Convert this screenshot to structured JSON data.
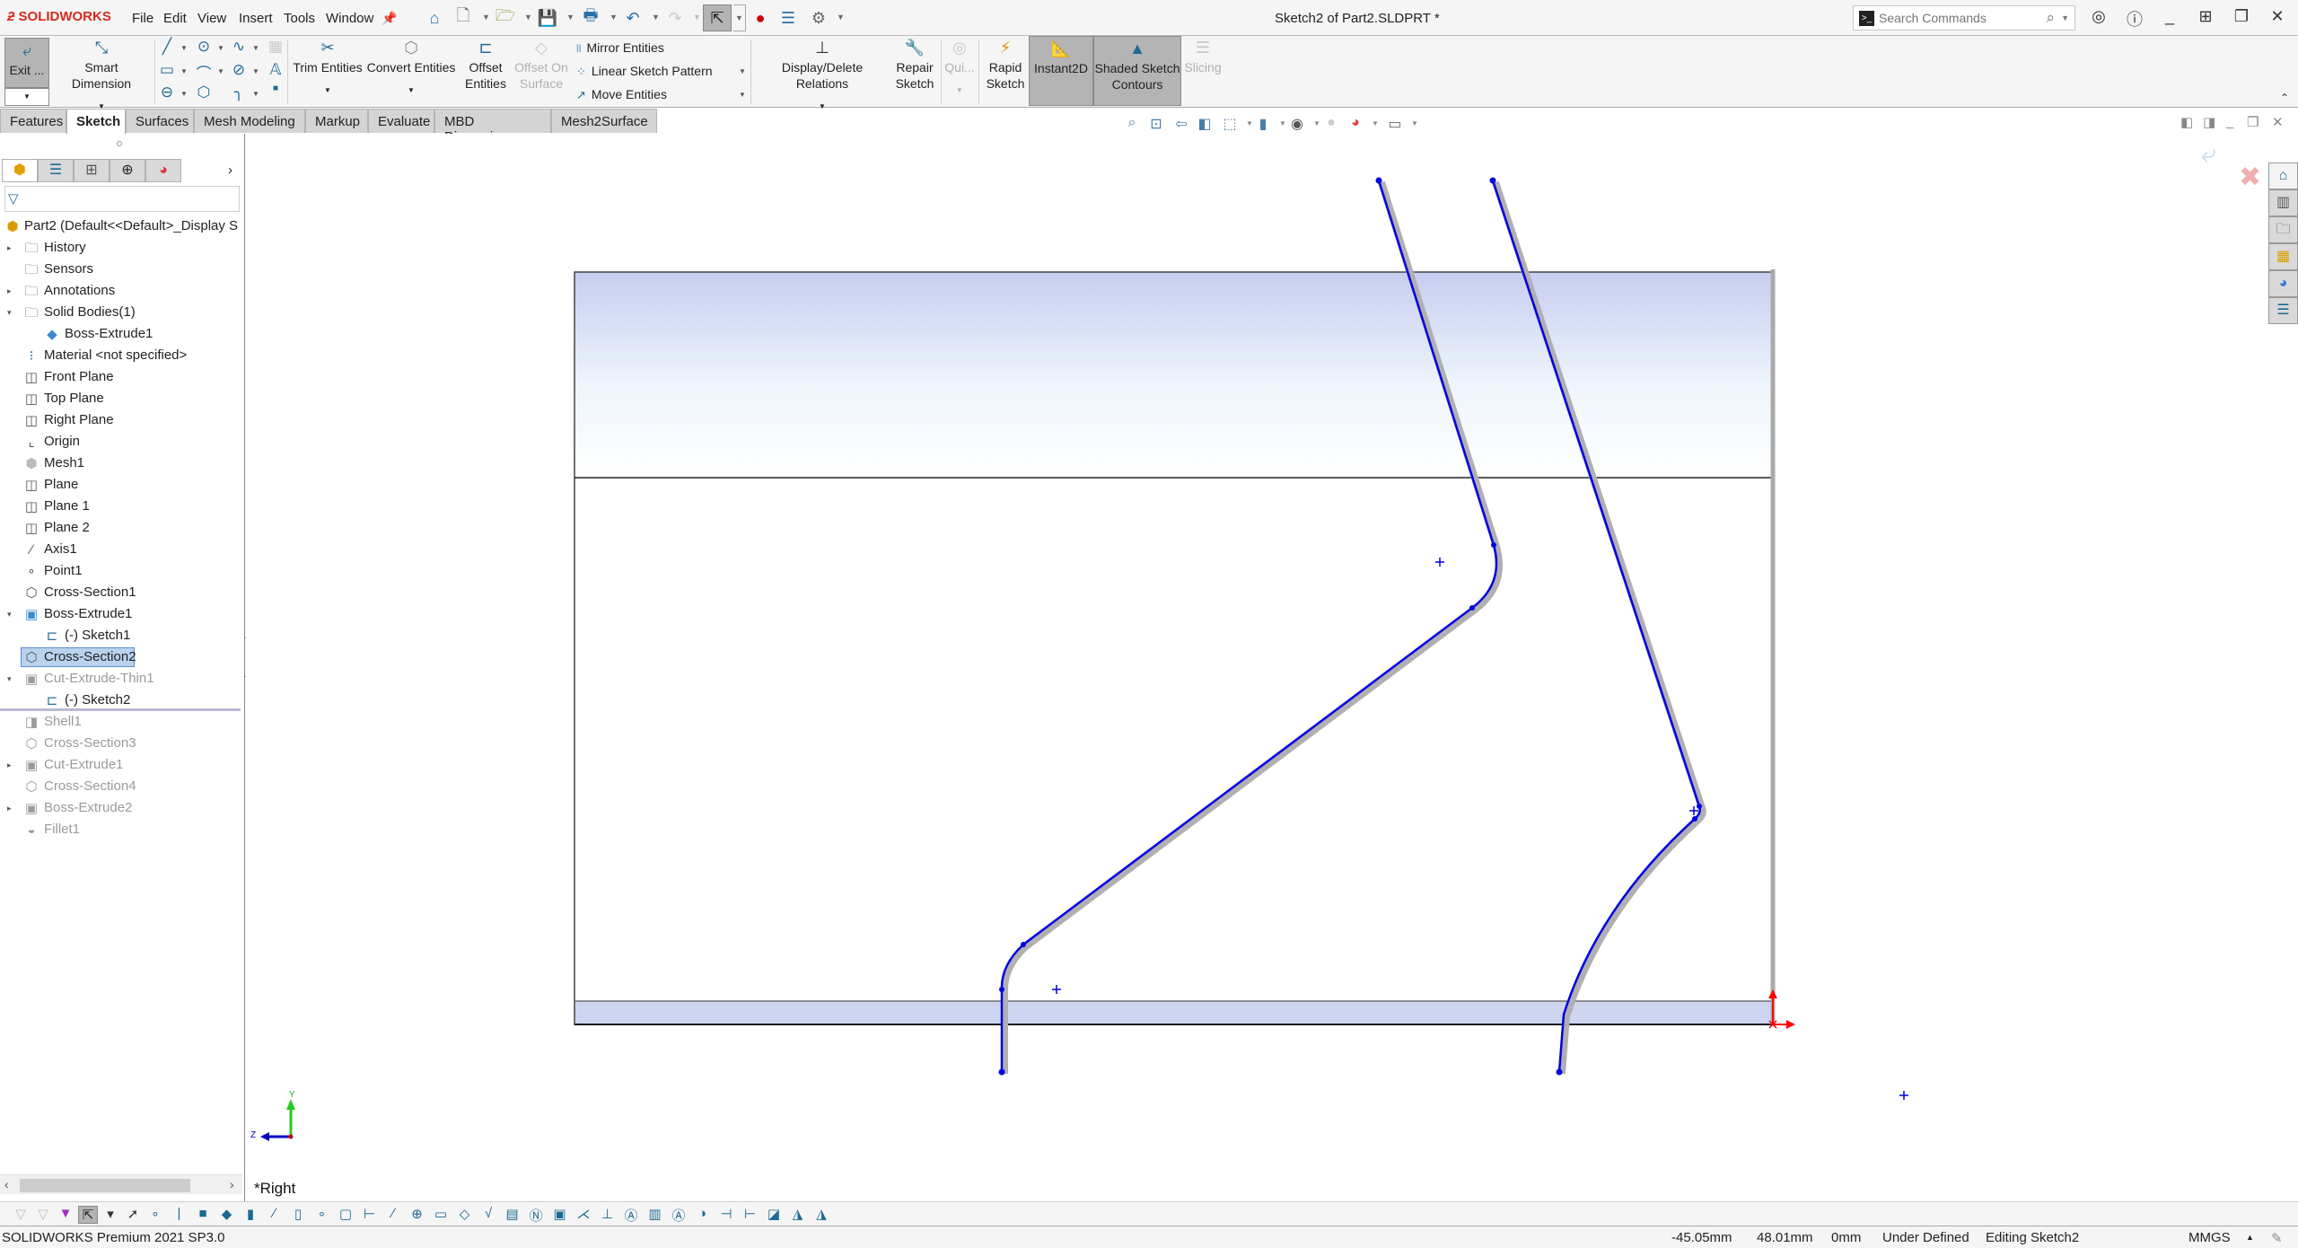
{
  "app": {
    "brand": "SOLIDWORKS",
    "window_title": "Sketch2 of Part2.SLDPRT *",
    "menu": [
      "File",
      "Edit",
      "View",
      "Insert",
      "Tools",
      "Window"
    ],
    "quick_access_icons": [
      "home-icon",
      "new-document-icon",
      "open-icon",
      "save-icon",
      "print-icon",
      "undo-icon",
      "redo-icon",
      "select-icon",
      "rebuild-icon",
      "file-properties-icon",
      "options-icon"
    ],
    "search": {
      "placeholder": "Search Commands"
    },
    "window_controls": [
      "user-icon",
      "help-icon",
      "minimize-icon",
      "tile-icon",
      "restore-icon",
      "close-icon"
    ]
  },
  "ribbon": {
    "exit_sketch": "Exit ...",
    "smart_dimension": "Smart Dimension",
    "trim_entities": "Trim Entities",
    "convert_entities": "Convert Entities",
    "offset_entities": [
      "Offset",
      "Entities"
    ],
    "offset_on_surface": [
      "Offset On",
      "Surface"
    ],
    "mirror_entities": "Mirror Entities",
    "linear_sketch_pattern": "Linear Sketch Pattern",
    "move_entities": "Move Entities",
    "display_delete_relations": "Display/Delete Relations",
    "repair_sketch": [
      "Repair",
      "Sketch"
    ],
    "quick_snaps": "Qui...",
    "rapid_sketch": [
      "Rapid",
      "Sketch"
    ],
    "instant2d": "Instant2D",
    "shaded_sketch_contours": [
      "Shaded Sketch",
      "Contours"
    ],
    "slicing": "Slicing",
    "sketch_tools": [
      "line-icon",
      "circle-icon",
      "spline-icon",
      "rectangle-icon",
      "arc-icon",
      "ellipse-icon",
      "text-icon",
      "slot-icon",
      "polygon-icon",
      "fillet-icon",
      "point-icon"
    ]
  },
  "tabs": [
    {
      "label": "Features",
      "active": false
    },
    {
      "label": "Sketch",
      "active": true
    },
    {
      "label": "Surfaces",
      "active": false
    },
    {
      "label": "Mesh Modeling",
      "active": false
    },
    {
      "label": "Markup",
      "active": false
    },
    {
      "label": "Evaluate",
      "active": false
    },
    {
      "label": "MBD Dimensions",
      "active": false
    },
    {
      "label": "Mesh2Surface",
      "active": false
    }
  ],
  "feature_tree": {
    "root": "Part2  (Default<<Default>_Display S",
    "items": [
      {
        "label": "History",
        "icon": "history-folder-icon",
        "expander": "collapsed",
        "indent": 0,
        "state": "normal"
      },
      {
        "label": "Sensors",
        "icon": "sensors-folder-icon",
        "expander": "none",
        "indent": 0,
        "state": "normal"
      },
      {
        "label": "Annotations",
        "icon": "annotations-folder-icon",
        "expander": "collapsed",
        "indent": 0,
        "state": "normal"
      },
      {
        "label": "Solid Bodies(1)",
        "icon": "solid-bodies-folder-icon",
        "expander": "expanded",
        "indent": 0,
        "state": "normal"
      },
      {
        "label": "Boss-Extrude1",
        "icon": "solid-body-icon",
        "expander": "none",
        "indent": 1,
        "state": "normal"
      },
      {
        "label": "Material <not specified>",
        "icon": "material-icon",
        "expander": "none",
        "indent": 0,
        "state": "normal"
      },
      {
        "label": "Front Plane",
        "icon": "plane-icon",
        "expander": "none",
        "indent": 0,
        "state": "normal"
      },
      {
        "label": "Top Plane",
        "icon": "plane-icon",
        "expander": "none",
        "indent": 0,
        "state": "normal"
      },
      {
        "label": "Right Plane",
        "icon": "plane-icon",
        "expander": "none",
        "indent": 0,
        "state": "normal"
      },
      {
        "label": "Origin",
        "icon": "origin-icon",
        "expander": "none",
        "indent": 0,
        "state": "normal"
      },
      {
        "label": "Mesh1",
        "icon": "mesh-icon",
        "expander": "none",
        "indent": 0,
        "state": "normal"
      },
      {
        "label": "Plane",
        "icon": "plane-icon",
        "expander": "none",
        "indent": 0,
        "state": "normal"
      },
      {
        "label": "Plane 1",
        "icon": "plane-icon",
        "expander": "none",
        "indent": 0,
        "state": "normal"
      },
      {
        "label": "Plane 2",
        "icon": "plane-icon",
        "expander": "none",
        "indent": 0,
        "state": "normal"
      },
      {
        "label": "Axis1",
        "icon": "axis-icon",
        "expander": "none",
        "indent": 0,
        "state": "normal"
      },
      {
        "label": "Point1",
        "icon": "point-icon",
        "expander": "none",
        "indent": 0,
        "state": "normal"
      },
      {
        "label": "Cross-Section1",
        "icon": "cross-section-icon",
        "expander": "none",
        "indent": 0,
        "state": "normal"
      },
      {
        "label": "Boss-Extrude1",
        "icon": "boss-extrude-icon",
        "expander": "expanded",
        "indent": 0,
        "state": "normal"
      },
      {
        "label": "(-) Sketch1",
        "icon": "sketch-icon",
        "expander": "none",
        "indent": 1,
        "state": "normal"
      },
      {
        "label": "Cross-Section2",
        "icon": "cross-section-icon",
        "expander": "none",
        "indent": 0,
        "state": "selected"
      },
      {
        "label": "Cut-Extrude-Thin1",
        "icon": "cut-extrude-icon",
        "expander": "expanded",
        "indent": 0,
        "state": "dim"
      },
      {
        "label": "(-) Sketch2",
        "icon": "sketch-icon",
        "expander": "none",
        "indent": 1,
        "state": "normal"
      },
      {
        "label": "Shell1",
        "icon": "shell-icon",
        "expander": "none",
        "indent": 0,
        "state": "dim"
      },
      {
        "label": "Cross-Section3",
        "icon": "cross-section-icon",
        "expander": "none",
        "indent": 0,
        "state": "dim"
      },
      {
        "label": "Cut-Extrude1",
        "icon": "cut-extrude-icon",
        "expander": "collapsed",
        "indent": 0,
        "state": "dim"
      },
      {
        "label": "Cross-Section4",
        "icon": "cross-section-icon",
        "expander": "none",
        "indent": 0,
        "state": "dim"
      },
      {
        "label": "Boss-Extrude2",
        "icon": "boss-extrude-icon",
        "expander": "collapsed",
        "indent": 0,
        "state": "dim"
      },
      {
        "label": "Fillet1",
        "icon": "fillet-icon",
        "expander": "none",
        "indent": 0,
        "state": "dim"
      }
    ]
  },
  "graphics": {
    "view_label": "*Right",
    "triad": {
      "y_label": "Y",
      "z_label": "Z"
    },
    "sketch_color": "#0000e6",
    "origin_color": "#ff0000"
  },
  "status_bar": {
    "product": "SOLIDWORKS Premium 2021 SP3.0",
    "x": "-45.05mm",
    "y": "48.01mm",
    "z": "0mm",
    "definition": "Under Defined",
    "mode": "Editing Sketch2",
    "units": "MMGS"
  }
}
